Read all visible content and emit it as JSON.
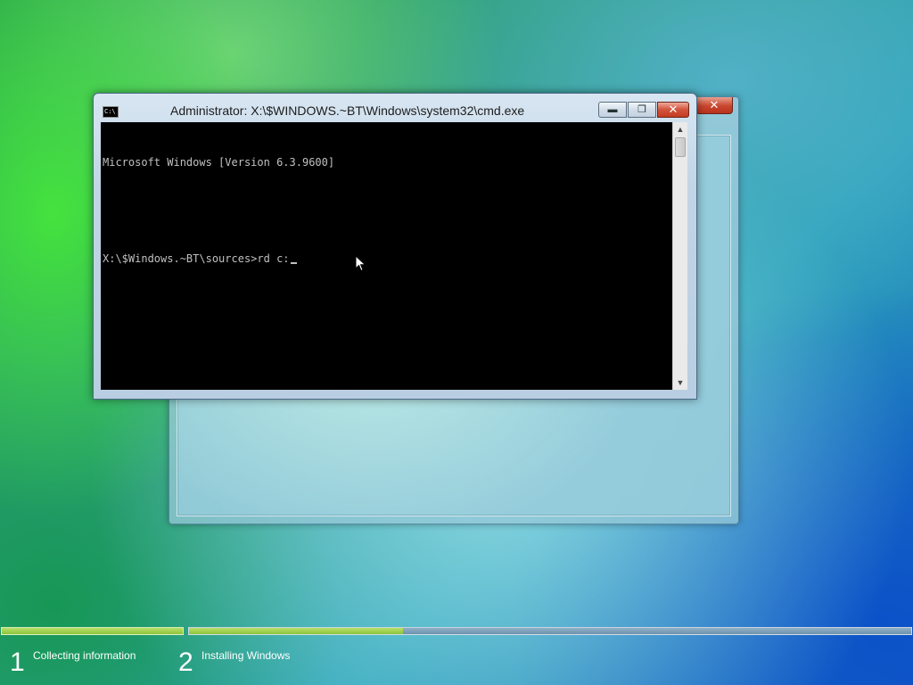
{
  "setup_window": {
    "close_glyph": "✕"
  },
  "cmd": {
    "title": "Administrator: X:\\$WINDOWS.~BT\\Windows\\system32\\cmd.exe",
    "icon_text": "C:\\",
    "lines": [
      "Microsoft Windows [Version 6.3.9600]",
      "",
      "X:\\$Windows.~BT\\sources>rd c:"
    ],
    "minimize_glyph": "▬",
    "maximize_glyph": "❐",
    "close_glyph": "✕",
    "scroll_up": "▲",
    "scroll_down": "▼"
  },
  "progress": {
    "step1_complete": 1.0,
    "step2_fraction": 0.296
  },
  "steps": [
    {
      "number": "1",
      "label": "Collecting information"
    },
    {
      "number": "2",
      "label": "Installing Windows"
    }
  ],
  "colors": {
    "progress_green": "#8cc43b",
    "console_bg": "#000000",
    "console_text": "#c0c0c0"
  }
}
